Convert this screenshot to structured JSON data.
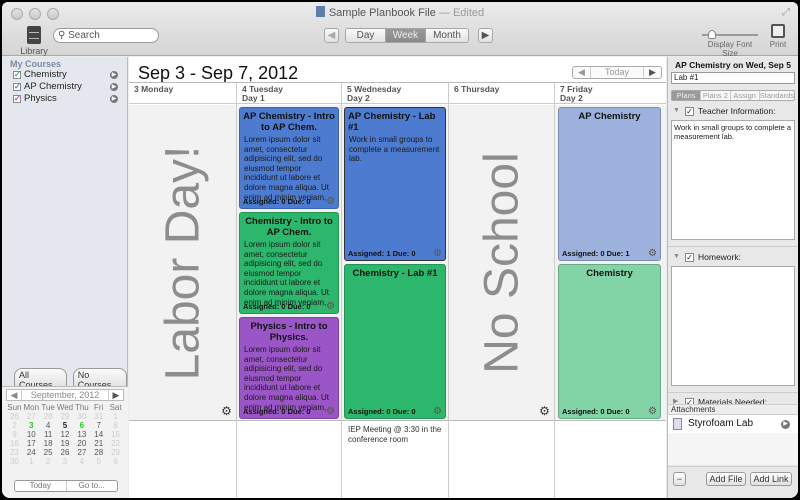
{
  "window": {
    "title": "Sample Planbook File",
    "title_sep": " — ",
    "status": "Edited"
  },
  "toolbar": {
    "library_label": "Library",
    "search_placeholder": "Search",
    "prev_label": "◀",
    "next_label": "▶",
    "views": [
      {
        "label": "Day",
        "active": false
      },
      {
        "label": "Week",
        "active": true
      },
      {
        "label": "Month",
        "active": false
      }
    ],
    "font_size_label": "Display Font Size",
    "font_size_value": 0.15,
    "print_label": "Print"
  },
  "sidebar": {
    "heading": "My Courses",
    "courses": [
      {
        "name": "Chemistry",
        "checked": true,
        "color": "#2cb76c"
      },
      {
        "name": "AP Chemistry",
        "checked": true,
        "color": "#4d7bcf"
      },
      {
        "name": "Physics",
        "checked": true,
        "color": "#9a55c6"
      }
    ],
    "all_courses": "All Courses",
    "no_courses": "No Courses",
    "minical": {
      "prev": "◀",
      "month": "September, 2012",
      "next": "▶",
      "dow": [
        "Sun",
        "Mon",
        "Tue",
        "Wed",
        "Thu",
        "Fri",
        "Sat"
      ],
      "days": [
        [
          "",
          "",
          "",
          "",
          "",
          "",
          "1"
        ],
        [
          "2",
          "3",
          "4",
          "5",
          "6",
          "7",
          "8"
        ],
        [
          "9",
          "10",
          "11",
          "12",
          "13",
          "14",
          "15"
        ],
        [
          "16",
          "17",
          "18",
          "19",
          "20",
          "21",
          "22"
        ],
        [
          "23",
          "24",
          "25",
          "26",
          "27",
          "28",
          "29"
        ],
        [
          "30",
          "",
          "",
          "",
          "",
          "",
          ""
        ]
      ],
      "today_label": "Today",
      "goto_label": "Go to..."
    }
  },
  "main": {
    "range": "Sep 3 - Sep 7, 2012",
    "nav_prev": "◀",
    "nav_today": "Today",
    "nav_next": "▶",
    "days": [
      {
        "date": "3 Monday",
        "rotation": "",
        "big_label": "Labor Day!",
        "note": ""
      },
      {
        "date": "4 Tuesday",
        "rotation": "Day 1",
        "big_label": "",
        "note": ""
      },
      {
        "date": "5 Wednesday",
        "rotation": "Day 2",
        "big_label": "",
        "note": "IEP Meeting @ 3:30 in the conference room"
      },
      {
        "date": "6 Thursday",
        "rotation": "",
        "big_label": "No School",
        "note": ""
      },
      {
        "date": "7 Friday",
        "rotation": "Day 2",
        "big_label": "",
        "note": ""
      }
    ],
    "cards": {
      "tue_ap": {
        "title": "AP Chemistry - Intro to AP Chem.",
        "body": "Lorem ipsum dolor sit amet, consectetur adipisicing elit, sed do eiusmod tempor incididunt ut labore et dolore magna aliqua. Ut enim ad minim veniam,",
        "footer": "Assigned: 0 Due: 0"
      },
      "tue_chem": {
        "title": "Chemistry - Intro to AP Chem.",
        "body": "Lorem ipsum dolor sit amet, consectetur adipisicing elit, sed do eiusmod tempor incididunt ut labore et dolore magna aliqua. Ut enim ad minim veniam,",
        "footer": "Assigned: 0 Due: 0"
      },
      "tue_phys": {
        "title": "Physics - Intro to Physics.",
        "body": "Lorem ipsum dolor sit amet, consectetur adipisicing elit, sed do eiusmod tempor incididunt ut labore et dolore magna aliqua. Ut enim ad minim veniam,",
        "footer": "Assigned: 0 Due: 0"
      },
      "wed_ap": {
        "title": "AP Chemistry - Lab #1",
        "body": "Work in small groups to complete a measurement lab.",
        "footer": "Assigned: 1 Due: 0"
      },
      "wed_chem": {
        "title": "Chemistry - Lab #1",
        "body": "",
        "footer": "Assigned: 0 Due: 0"
      },
      "fri_ap": {
        "title": "AP Chemistry",
        "body": "",
        "footer": "Assigned: 0 Due: 1"
      },
      "fri_chem": {
        "title": "Chemistry",
        "body": "",
        "footer": "Assigned: 0 Due: 0"
      }
    }
  },
  "inspector": {
    "title": "AP Chemistry on Wed, Sep 5",
    "lesson_name": "Lab #1",
    "tabs": [
      {
        "label": "Plans",
        "active": true
      },
      {
        "label": "Plans 2",
        "active": false
      },
      {
        "label": "Assign",
        "active": false
      },
      {
        "label": "Standards",
        "active": false
      }
    ],
    "teacher_info_label": "Teacher Information:",
    "teacher_info_text": "Work in small groups to complete a measurement lab.",
    "homework_label": "Homework:",
    "homework_text": "",
    "materials_label": "Materials Needed:",
    "attachments_label": "Attachments",
    "attachments": [
      {
        "name": "Styrofoam Lab"
      }
    ],
    "remove_label": "−",
    "add_file_label": "Add File",
    "add_link_label": "Add Link"
  }
}
